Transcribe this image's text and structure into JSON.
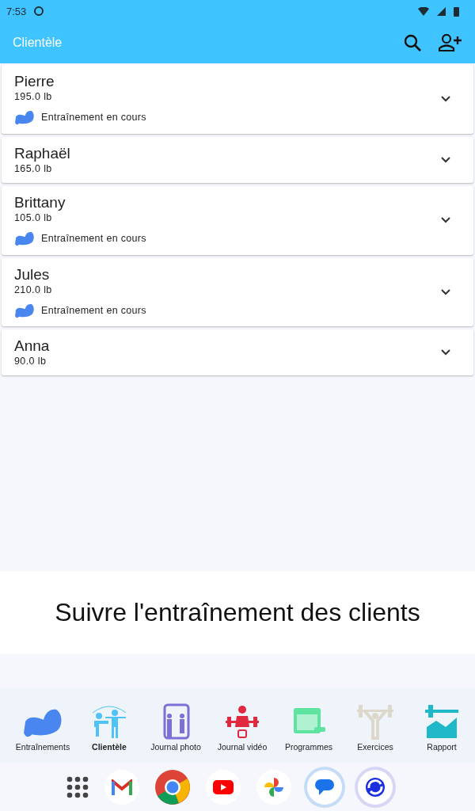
{
  "status_bar": {
    "time": "7:53"
  },
  "app_bar": {
    "title": "Clientèle"
  },
  "clients": [
    {
      "name": "Pierre",
      "weight": "195.0 lb",
      "status": "Entraînement en cours"
    },
    {
      "name": "Raphaël",
      "weight": "165.0 lb"
    },
    {
      "name": "Brittany",
      "weight": "105.0 lb",
      "status": "Entraînement en cours"
    },
    {
      "name": "Jules",
      "weight": "210.0 lb",
      "status": "Entraînement en cours"
    },
    {
      "name": "Anna",
      "weight": "90.0 lb"
    }
  ],
  "banner": "Suivre l'entraînement des clients",
  "tabs": [
    {
      "kind": "workouts",
      "label": "Entraînements",
      "selected": false
    },
    {
      "kind": "clients",
      "label": "Clientèle",
      "selected": true
    },
    {
      "kind": "photo",
      "label": "Journal photo",
      "selected": false
    },
    {
      "kind": "video",
      "label": "Journal vidéo",
      "selected": false
    },
    {
      "kind": "programs",
      "label": "Programmes",
      "selected": false
    },
    {
      "kind": "exercises",
      "label": "Exercices",
      "selected": false
    },
    {
      "kind": "reports",
      "label": "Rapport",
      "selected": false
    }
  ]
}
